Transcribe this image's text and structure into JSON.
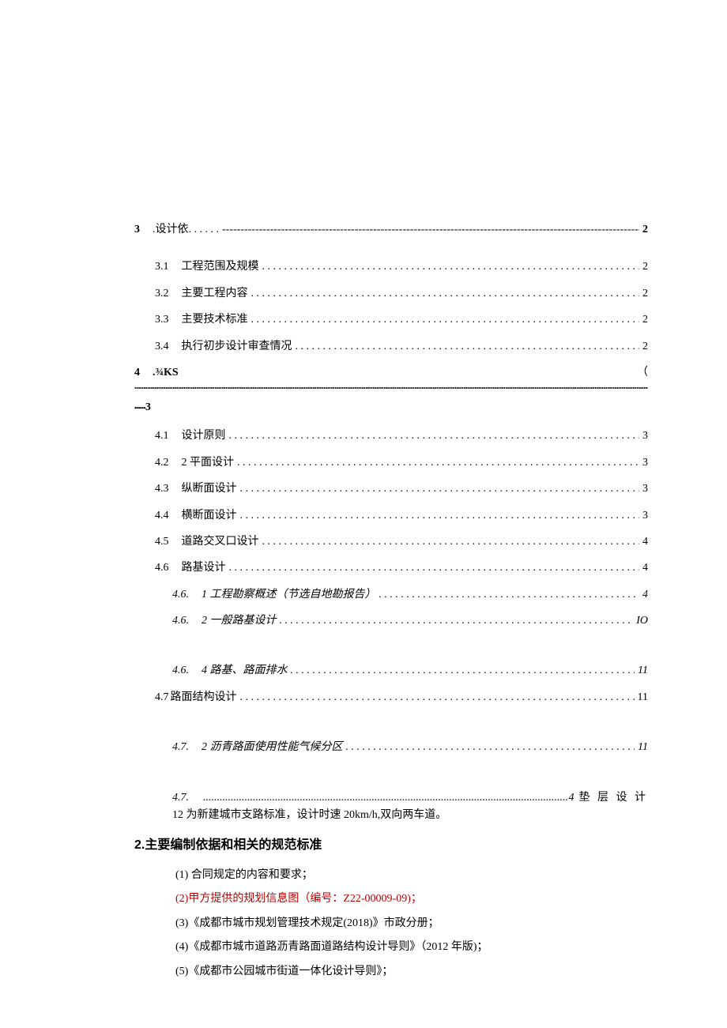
{
  "toc": {
    "sec3": {
      "num": "3",
      "title": ".设计依. . . . . .",
      "page": "2"
    },
    "sec3_1": {
      "num": "3.1",
      "title": "工程范围及规模",
      "page": "2"
    },
    "sec3_2": {
      "num": "3.2",
      "title": "主要工程内容",
      "page": "2"
    },
    "sec3_3": {
      "num": "3.3",
      "title": "主要技术标准",
      "page": "2"
    },
    "sec3_4": {
      "num": "3.4",
      "title": "执行初步设计审查情况",
      "page": "2"
    },
    "sec4": {
      "num": "4",
      "title": ".¾KS",
      "page": "（",
      "tailpage": "3"
    },
    "sec4_1": {
      "num": "4.1",
      "title": "设计原则",
      "page": "3"
    },
    "sec4_2": {
      "num": "4.2",
      "title": "2 平面设计",
      "page": "3"
    },
    "sec4_3": {
      "num": "4.3",
      "title": "纵断面设计",
      "page": "3"
    },
    "sec4_4": {
      "num": "4.4",
      "title": "横断面设计",
      "page": "3"
    },
    "sec4_5": {
      "num": "4.5",
      "title": "道路交叉口设计",
      "page": "4"
    },
    "sec4_6": {
      "num": "4.6",
      "title": "路基设计",
      "page": "4"
    },
    "sec4_6_1": {
      "num": "4.6.",
      "title": "1 工程勘察概述（节选自地勘报告）",
      "page": "4"
    },
    "sec4_6_2": {
      "num": "4.6.",
      "title": "2 一般路基设计",
      "page": "IO"
    },
    "sec4_6_4": {
      "num": "4.6.",
      "title": "4 路基、路面排水",
      "page": "11"
    },
    "sec4_7": {
      "num": "4.7",
      "title": "路面结构设计",
      "page": "11"
    },
    "sec4_7_2": {
      "num": "4.7.",
      "title": "2 沥青路面使用性能气候分区",
      "page": "11"
    },
    "sec4_7_4": {
      "num": "4.7.",
      "page": "4",
      "tail": "垫 层 设 计"
    }
  },
  "body": {
    "line12": "12 为新建城市支路标准，设计时速 20km/h,双向两车道。",
    "h2": "2.主要编制依据和相关的规范标准",
    "items": [
      "(1) 合同规定的内容和要求；",
      "(2)甲方提供的规划信息图（编号：Z22-00009-09)；",
      "(3)《成都市城市规划管理技术规定(2018)》市政分册；",
      "(4)《成都市城市道路沥青路面道路结构设计导则》（2012 年版)；",
      "(5)《成都市公园城市街道一体化设计导则》；"
    ]
  },
  "dense_dots": "••••••",
  "dense_full": "•••••••••••••••••••••••••••••••••••••••••••••••••••••••••••••••••••••••••••••••••••••••••••••••••••••••••••••••••••••••••••••••••••••••••••••••••••••••••••••••••••••••••••••••••••••••••••••••••••••••••••••••••••••••••••••••••••••••••••••••••••••••••••••••••••••••••••••••••••••••••••••••••••••••••••••••••••••••••••••••••••••••••••••••••••••••••••••••••••••••••••"
}
